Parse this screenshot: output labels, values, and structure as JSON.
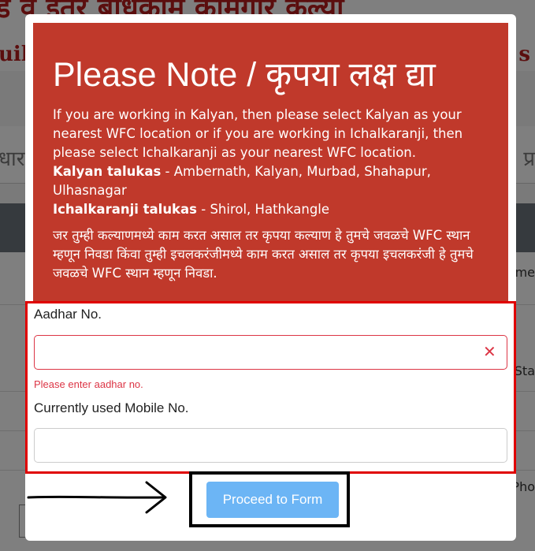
{
  "background": {
    "title_line1": "ड व इतर बांधकाम कामगार कल्या",
    "title_line2_left": "uil",
    "title_line2_right": "s",
    "nav_left": "धार",
    "nav_right": "प्र",
    "table_cells": [
      "me",
      "Sta",
      "Pho"
    ]
  },
  "modal": {
    "note": {
      "title": "Please Note / कृपया लक्ष द्या",
      "line1": "If you are working in Kalyan, then please select Kalyan as your nearest WFC location or if you are working in Ichalkaranji, then please select Ichalkaranji as your nearest WFC location.",
      "kalyan_label": "Kalyan talukas",
      "kalyan_value": " - Ambernath, Kalyan, Murbad, Shahapur, Ulhasnagar",
      "ichal_label": "Ichalkaranji talukas",
      "ichal_value": " - Shirol, Hathkangle",
      "marathi_text": "जर तुम्ही कल्याणमध्ये काम करत असाल तर कृपया कल्याण हे तुमचे जवळचे WFC स्थान म्हणून निवडा किंवा तुम्ही इचलकरंजीमध्ये काम करत असाल तर कृपया इचलकरंजी हे तुमचे जवळचे WFC स्थान म्हणून निवडा."
    },
    "form": {
      "aadhar_label": "Aadhar No.",
      "aadhar_value": "",
      "aadhar_error": "Please enter aadhar no.",
      "mobile_label": "Currently used Mobile No.",
      "mobile_value": ""
    },
    "proceed_button": "Proceed to Form"
  },
  "colors": {
    "note_panel": "#c0392b",
    "error": "#dc3545",
    "button": "#6cb5f5",
    "highlight_box": "#e00000"
  },
  "icons": {
    "clear": "close-icon",
    "annotation": "arrow-right-icon"
  }
}
